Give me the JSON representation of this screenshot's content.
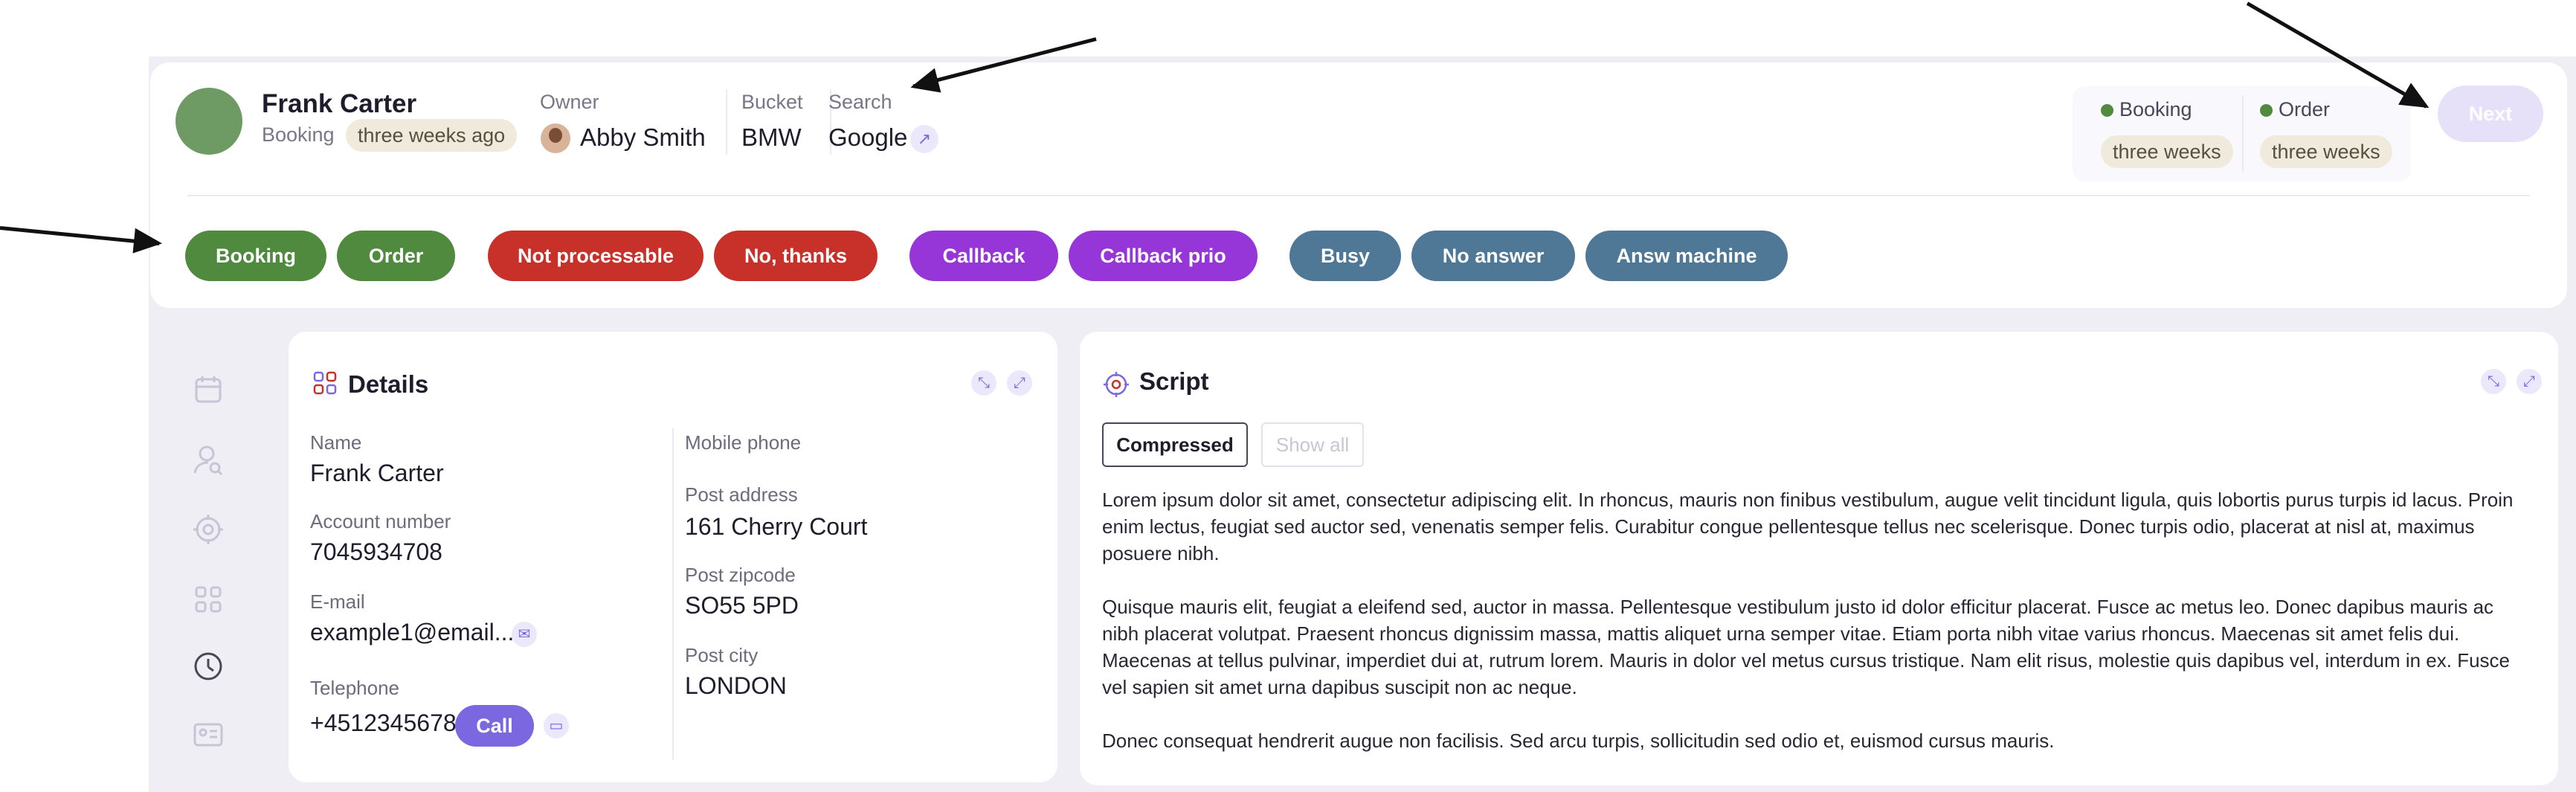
{
  "lead": {
    "name": "Frank Carter",
    "status_label": "Booking",
    "status_time": "three weeks ago",
    "owner_label": "Owner",
    "owner_name": "Abby Smith",
    "bucket_label": "Bucket",
    "bucket_value": "BMW",
    "search_label": "Search",
    "search_value": "Google"
  },
  "status_box": [
    {
      "title": "Booking",
      "time": "three weeks"
    },
    {
      "title": "Order",
      "time": "three weeks"
    }
  ],
  "next_label": "Next",
  "actions": [
    "Booking",
    "Order",
    "Not processable",
    "No, thanks",
    "Callback",
    "Callback prio",
    "Busy",
    "No answer",
    "Answ machine"
  ],
  "colors": {
    "green": "#4f8a3f",
    "red": "#c8302a",
    "purple": "#9636d8",
    "slate": "#4f7897",
    "accent": "#7b67e0"
  },
  "sidebar_icons": [
    "calendar-icon",
    "user-search-icon",
    "target-icon",
    "apps-icon",
    "clock-icon",
    "contact-card-icon"
  ],
  "details": {
    "title": "Details",
    "name_label": "Name",
    "name_value": "Frank Carter",
    "account_label": "Account number",
    "account_value": "7045934708",
    "email_label": "E-mail",
    "email_value": "example1@email...",
    "phone_label": "Telephone",
    "phone_value": "+4512345678",
    "call_label": "Call",
    "mobile_label": "Mobile phone",
    "address_label": "Post address",
    "address_value": "161 Cherry Court",
    "zip_label": "Post zipcode",
    "zip_value": "SO55 5PD",
    "city_label": "Post city",
    "city_value": "LONDON"
  },
  "script": {
    "title": "Script",
    "tab_compressed": "Compressed",
    "tab_show_all": "Show all",
    "paragraphs": [
      "Lorem ipsum dolor sit amet, consectetur adipiscing elit. In rhoncus, mauris non finibus vestibulum, augue velit tincidunt ligula, quis lobortis purus turpis id lacus. Proin enim lectus, feugiat sed auctor sed, venenatis semper felis. Curabitur congue pellentesque tellus nec scelerisque. Donec turpis odio, placerat at nisl at, maximus posuere nibh.",
      "Quisque mauris elit, feugiat a eleifend sed, auctor in massa. Pellentesque vestibulum justo id dolor efficitur placerat. Fusce ac metus leo. Donec dapibus mauris ac nibh placerat volutpat. Praesent rhoncus dignissim massa, mattis aliquet urna semper vitae. Etiam porta nibh vitae varius rhoncus. Maecenas sit amet felis dui. Maecenas at tellus pulvinar, imperdiet dui at, rutrum lorem. Mauris in dolor vel metus cursus tristique. Nam elit risus, molestie quis dapibus vel, interdum in ex. Fusce vel sapien sit amet urna dapibus suscipit non ac neque.",
      "Donec consequat hendrerit augue non facilisis. Sed arcu turpis, sollicitudin sed odio et, euismod cursus mauris."
    ]
  }
}
